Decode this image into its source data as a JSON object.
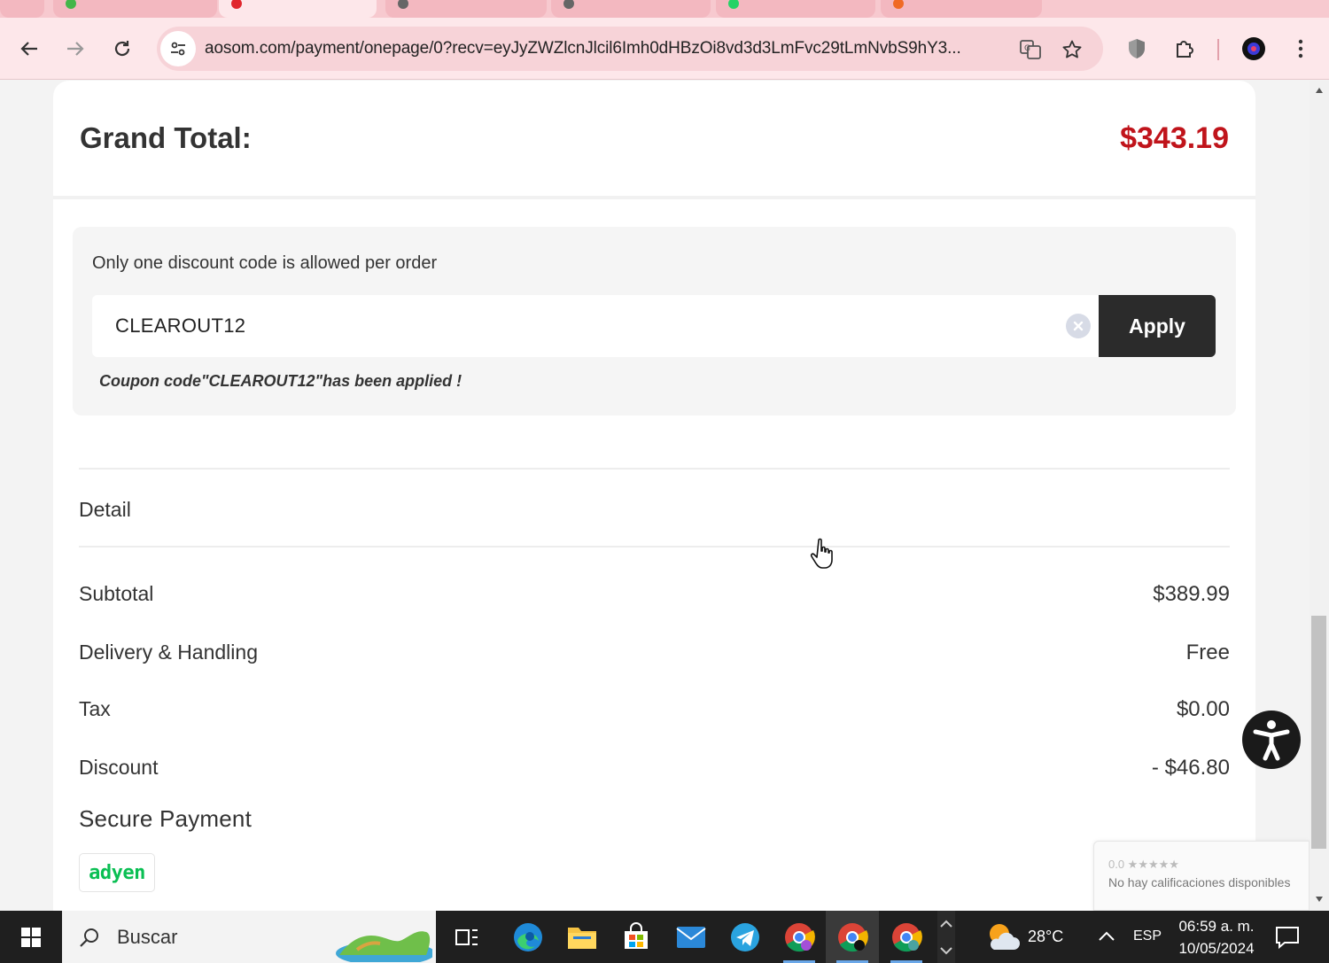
{
  "browser": {
    "url": "aosom.com/payment/onepage/0?recv=eyJyZWZlcnJlcil6Imh0dHBzOi8vd3d3LmFvc29tLmNvbS9hY3..."
  },
  "order": {
    "grand_total_label": "Grand Total:",
    "grand_total_value": "$343.19"
  },
  "coupon": {
    "note": "Only one discount code is allowed per order",
    "code_value": "CLEAROUT12",
    "apply_label": "Apply",
    "applied_message": "Coupon code\"CLEAROUT12\"has been applied !"
  },
  "detail": {
    "title": "Detail",
    "rows": [
      {
        "label": "Subtotal",
        "value": "$389.99"
      },
      {
        "label": "Delivery & Handling",
        "value": "Free"
      },
      {
        "label": "Tax",
        "value": "$0.00"
      },
      {
        "label": "Discount",
        "value": "- $46.80"
      }
    ]
  },
  "secure_payment": {
    "title": "Secure Payment",
    "provider_logo": "adyen"
  },
  "rating_widget": {
    "score": "0.0 ★★★★★",
    "text": "No hay calificaciones disponibles"
  },
  "taskbar": {
    "search_placeholder": "Buscar",
    "weather": "28°C",
    "language": "ESP",
    "time": "06:59 a. m.",
    "date": "10/05/2024"
  },
  "colors": {
    "accent_price": "#c0141b",
    "browser_frame": "#fde7ea",
    "apply_button": "#2b2b2b",
    "adyen_green": "#0abf53"
  }
}
